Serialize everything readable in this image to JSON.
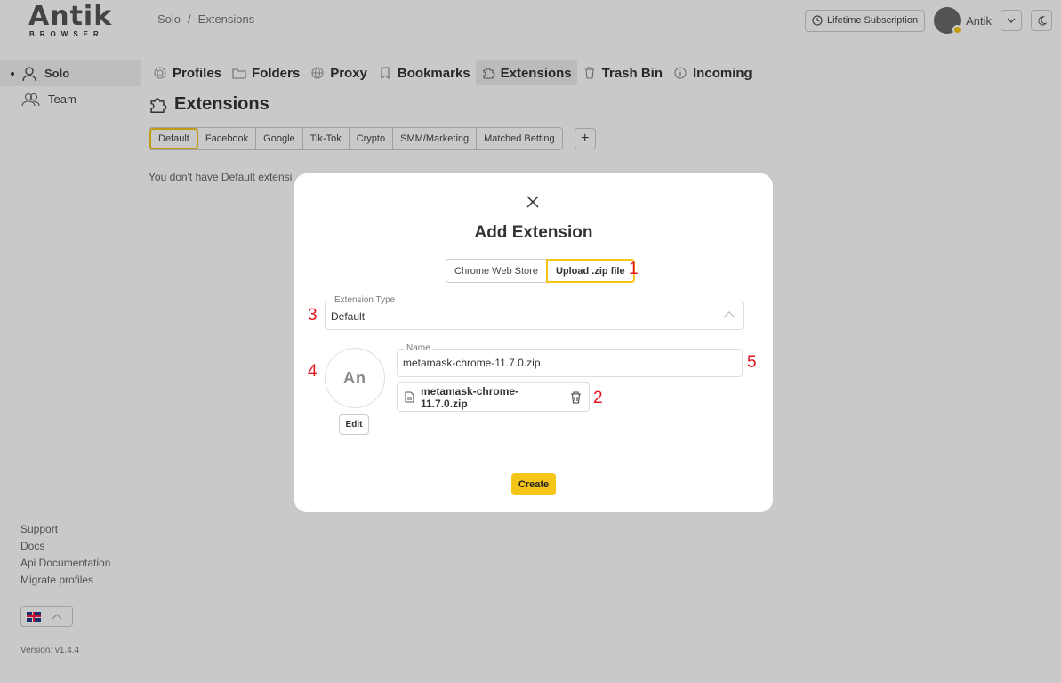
{
  "app": {
    "logo_text": "Antik",
    "logo_sub": "BROWSER"
  },
  "breadcrumb": [
    "Solo",
    "/",
    "Extensions"
  ],
  "header": {
    "lifetime_label": "Lifetime Subscription",
    "user_name": "Antik"
  },
  "sidebar": {
    "items": [
      {
        "label": "Solo",
        "icon": "user-icon"
      },
      {
        "label": "Team",
        "icon": "team-icon"
      }
    ]
  },
  "tabs": [
    {
      "label": "Profiles",
      "icon": "fingerprint-icon"
    },
    {
      "label": "Folders",
      "icon": "folder-icon"
    },
    {
      "label": "Proxy",
      "icon": "globe-icon"
    },
    {
      "label": "Bookmarks",
      "icon": "bookmark-icon"
    },
    {
      "label": "Extensions",
      "icon": "puzzle-icon"
    },
    {
      "label": "Trash Bin",
      "icon": "trash-icon"
    },
    {
      "label": "Incoming",
      "icon": "info-icon"
    }
  ],
  "page": {
    "title": "Extensions",
    "categories": [
      "Default",
      "Facebook",
      "Google",
      "Tik-Tok",
      "Crypto",
      "SMM/Marketing",
      "Matched Betting"
    ],
    "add_label": "+",
    "empty_message": "You don't have Default extensi"
  },
  "footer": {
    "links": [
      "Support",
      "Docs",
      "Api Documentation",
      "Migrate profiles"
    ],
    "version": "Version: v1.4.4"
  },
  "modal": {
    "title": "Add Extension",
    "sources": [
      "Chrome Web Store",
      "Upload .zip file"
    ],
    "type_label": "Extension Type",
    "type_value": "Default",
    "icon_text": "An",
    "edit_label": "Edit",
    "name_label": "Name",
    "name_value": "metamask-chrome-11.7.0.zip",
    "file_name": "metamask-chrome-11.7.0.zip",
    "create_label": "Create"
  },
  "annotations": [
    "1",
    "2",
    "3",
    "4",
    "5"
  ],
  "colors": {
    "accent": "#f5c518",
    "annotation": "#e0141e"
  }
}
